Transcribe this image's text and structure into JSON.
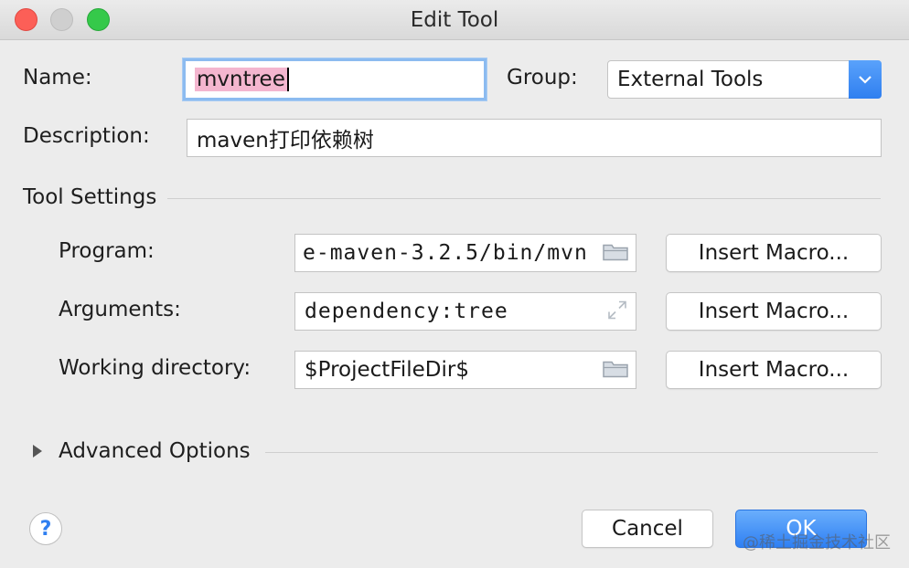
{
  "window": {
    "title": "Edit Tool"
  },
  "form": {
    "name_label": "Name:",
    "name_value": "mvntree",
    "group_label": "Group:",
    "group_value": "External Tools",
    "description_label": "Description:",
    "description_value": "maven打印依赖树"
  },
  "tool_settings": {
    "section_label": "Tool Settings",
    "program_label": "Program:",
    "program_value": "e-maven-3.2.5/bin/mvn",
    "arguments_label": "Arguments:",
    "arguments_value": "dependency:tree",
    "working_dir_label": "Working directory:",
    "working_dir_value": "$ProjectFileDir$",
    "insert_macro_label": "Insert Macro..."
  },
  "advanced": {
    "label": "Advanced Options",
    "expanded": false
  },
  "footer": {
    "help_label": "?",
    "cancel_label": "Cancel",
    "ok_label": "OK"
  },
  "watermark": "@稀土掘金技术社区",
  "icons": {
    "folder": "folder-icon",
    "expand": "expand-icon",
    "dropdown": "chevron-down-icon",
    "disclosure": "disclosure-triangle-icon"
  },
  "colors": {
    "accent": "#2f80f3",
    "focus_ring": "#8cbbf0",
    "selection": "#f4b6cf",
    "close": "#fc5f57",
    "zoom": "#35c94a"
  }
}
